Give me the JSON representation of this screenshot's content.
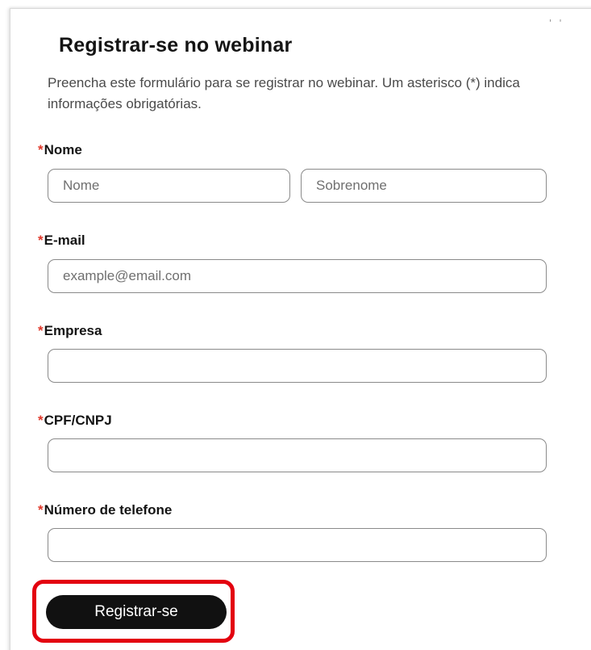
{
  "dialog": {
    "close_glyph": "' '",
    "title": "Registrar-se no webinar",
    "description": "Preencha este formulário para se registrar no webinar. Um asterisco (*) indica informações obrigatórias."
  },
  "form": {
    "required_mark": "*",
    "name": {
      "label": "Nome",
      "first_placeholder": "Nome",
      "last_placeholder": "Sobrenome"
    },
    "email": {
      "label": "E-mail",
      "placeholder": "example@email.com"
    },
    "company": {
      "label": "Empresa",
      "placeholder": ""
    },
    "tax_id": {
      "label": "CPF/CNPJ",
      "placeholder": ""
    },
    "phone": {
      "label": "Número de telefone",
      "placeholder": ""
    },
    "submit_label": "Registrar-se"
  },
  "colors": {
    "required_star": "#e0392b",
    "button_bg": "#111111",
    "highlight_border": "#e3000f"
  }
}
